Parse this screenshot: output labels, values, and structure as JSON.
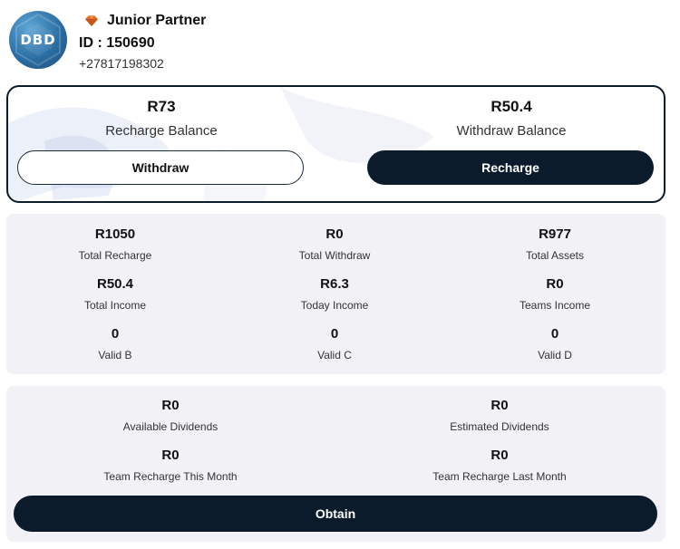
{
  "profile": {
    "logo_text": "DBD",
    "rank_icon": "gem-icon",
    "rank_title": "Junior Partner",
    "id_text": "ID : 150690",
    "phone": "+27817198302"
  },
  "balance": {
    "recharge_value": "R73",
    "recharge_label": "Recharge Balance",
    "withdraw_value": "R50.4",
    "withdraw_label": "Withdraw Balance",
    "withdraw_button": "Withdraw",
    "recharge_button": "Recharge"
  },
  "stats": [
    {
      "value": "R1050",
      "label": "Total Recharge"
    },
    {
      "value": "R0",
      "label": "Total Withdraw"
    },
    {
      "value": "R977",
      "label": "Total Assets"
    },
    {
      "value": "R50.4",
      "label": "Total Income"
    },
    {
      "value": "R6.3",
      "label": "Today Income"
    },
    {
      "value": "R0",
      "label": "Teams Income"
    },
    {
      "value": "0",
      "label": "Valid B"
    },
    {
      "value": "0",
      "label": "Valid C"
    },
    {
      "value": "0",
      "label": "Valid D"
    }
  ],
  "dividends": {
    "items": [
      {
        "value": "R0",
        "label": "Available Dividends"
      },
      {
        "value": "R0",
        "label": "Estimated Dividends"
      },
      {
        "value": "R0",
        "label": "Team Recharge This Month"
      },
      {
        "value": "R0",
        "label": "Team Recharge Last Month"
      }
    ],
    "obtain_button": "Obtain"
  },
  "colors": {
    "primary_dark": "#0b1b2b",
    "panel_bg": "#f2f2f6",
    "logo_blue": "#2b6ea3",
    "rank_icon": "#e0702a"
  }
}
